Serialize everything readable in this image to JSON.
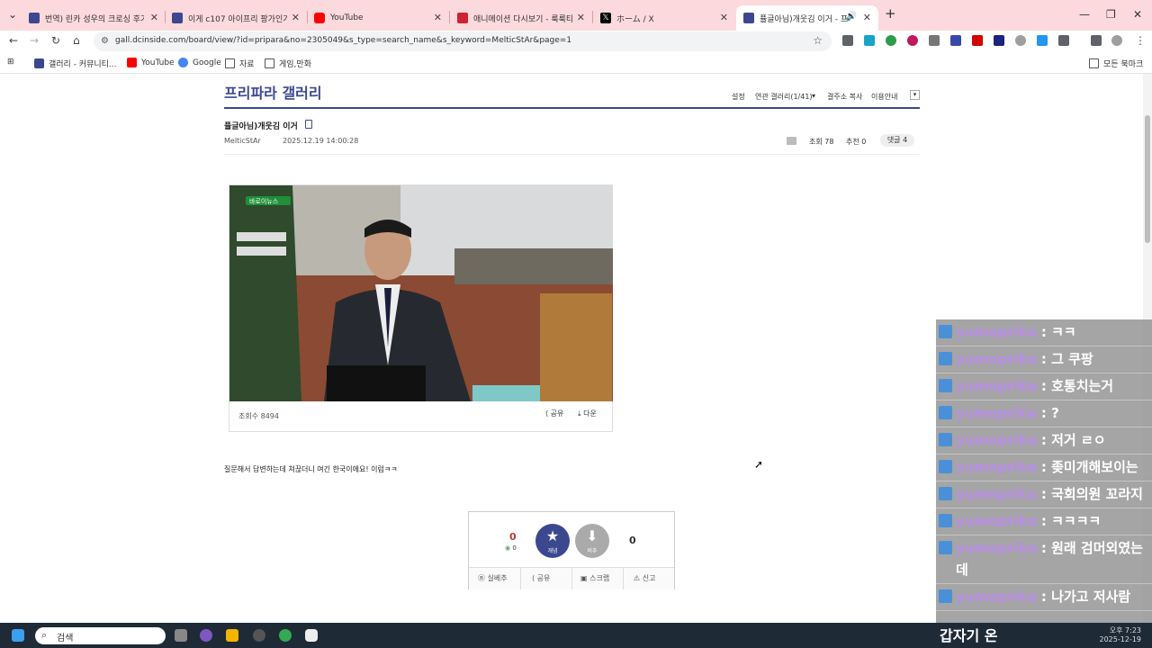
{
  "browser": {
    "tabs": [
      {
        "title": "번역) 린카 성우의 크로싱 후기",
        "favicon_color": "#3b4890"
      },
      {
        "title": "이게 c107 아이프리 팡가인가?",
        "favicon_color": "#3b4890"
      },
      {
        "title": "YouTube",
        "favicon_color": "#ff0000"
      },
      {
        "title": "애니메이션 다시보기 - 룩룩티비",
        "favicon_color": "#cc2233"
      },
      {
        "title": "ホーム / X",
        "favicon_color": "#000000"
      },
      {
        "title": "퓰글아님)개웃김 이거 - 프리",
        "favicon_color": "#3b4890"
      }
    ],
    "url": "gall.dcinside.com/board/view/?id=pripara&no=2305049&s_type=search_name&s_keyword=MelticStAr&page=1",
    "bookmarks": [
      {
        "label": "갤러리 - 커뮤니티...",
        "icon_color": "#3b4890"
      },
      {
        "label": "YouTube",
        "icon_color": "#ff0000"
      },
      {
        "label": "Google",
        "icon_color": "#4285f4"
      },
      {
        "label": "자료",
        "icon": "folder-icon"
      },
      {
        "label": "게임,만화",
        "icon": "folder-icon"
      }
    ],
    "all_bookmarks": "모든 북마크"
  },
  "gallery": {
    "title": "프리파라 갤러리",
    "menu": [
      "설정",
      "연관 갤러리(1/41)",
      "결주소 복사",
      "이용안내"
    ]
  },
  "post": {
    "title": "퓰글아님)개웃김 이거",
    "author": "MelticStAr",
    "datetime": "2025.12.19 14:00:28",
    "views": "조회 78",
    "recommend": "추천 0",
    "comments": "댓글 4",
    "video_views": "조회수 8494",
    "share": "공유",
    "download": "다운",
    "video_badge": "바로이뉴스",
    "body": "질문해서 답변하는데 쳐끊더니 여긴 한국이에요! 이럼ㅋㅋ"
  },
  "vote": {
    "up_count": "0",
    "up_sub": "0",
    "up_label": "개념",
    "down_label": "비추",
    "down_count": "0",
    "actions": [
      "실베추",
      "공유",
      "스크랩",
      "신고"
    ]
  },
  "chat": {
    "messages": [
      {
        "name": "yumeprika",
        "text": "ㅋㅋ"
      },
      {
        "name": "yumeprika",
        "text": "그 쿠팡"
      },
      {
        "name": "yumeprika",
        "text": "호통치는거"
      },
      {
        "name": "yumeprika",
        "text": "?"
      },
      {
        "name": "yumeprika",
        "text": "저거 ㄹㅇ"
      },
      {
        "name": "yumeprika",
        "text": "좆미개해보이는"
      },
      {
        "name": "yumeprika",
        "text": "국회의원 꼬라지"
      },
      {
        "name": "yumeprika",
        "text": "ㅋㅋㅋㅋ"
      },
      {
        "name": "yumeprika",
        "text": "원래 검머외였는데"
      },
      {
        "name": "yumeprika",
        "text": "나가고 저사람"
      }
    ],
    "overlay": "갑자기 온"
  },
  "taskbar": {
    "search": "검색",
    "time": "오후 7:23",
    "date": "2025-12-19"
  }
}
